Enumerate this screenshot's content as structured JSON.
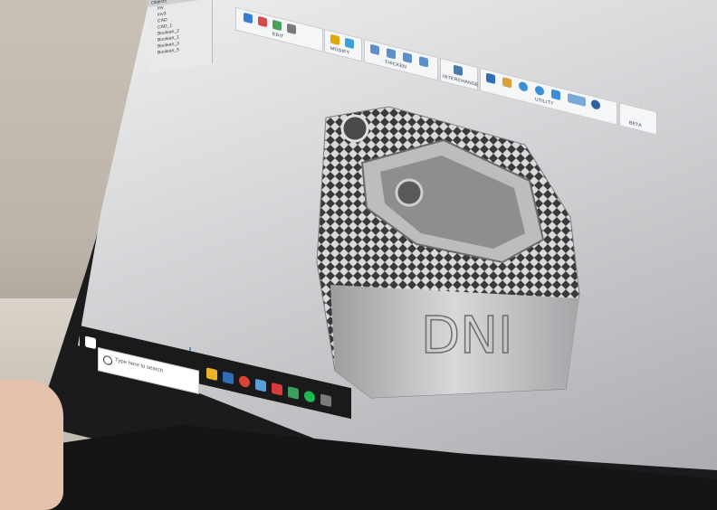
{
  "tree": {
    "title": "Objects",
    "items": [
      "Inv",
      "Inv3",
      "CAD",
      "CAD_1",
      "Boolean_2",
      "Boolean_1",
      "Boolean_3",
      "Boolean_5"
    ]
  },
  "ribbon": {
    "groups": [
      "EDIT",
      "MODIFY",
      "THICKEN",
      "INTERCHANGE",
      "UTILITY",
      "BETA"
    ]
  },
  "taskbar": {
    "search_placeholder": "Type here to search"
  },
  "model": {
    "engraving": "DNI"
  },
  "colors": {
    "screen_bg": "#d6d6d9",
    "model_grey": "#bdbdbf",
    "taskbar": "#1a1a1a"
  }
}
